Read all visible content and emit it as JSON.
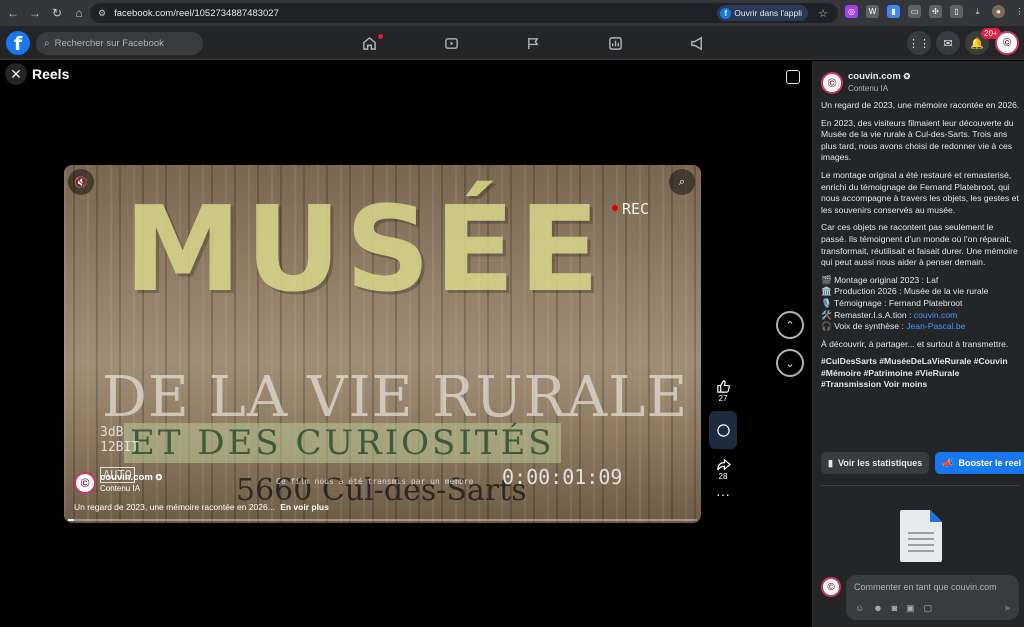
{
  "browser": {
    "url": "facebook.com/reel/1052734887483027",
    "open_app_label": "Ouvrir dans l'appli"
  },
  "header": {
    "search_placeholder": "Rechercher sur Facebook",
    "notifications_badge": "20+"
  },
  "reels": {
    "title": "Reels"
  },
  "video": {
    "overlay_musee": "MUSÉE",
    "overlay_vie": "DE LA VIE RURALE",
    "overlay_curio": "ET DES CURIOSITÉS",
    "overlay_city": "5660 Cul-des-Sarts",
    "overlay_rec": "REC",
    "overlay_db": "3dB\n12BIT",
    "overlay_auto": "AUTO",
    "overlay_time": "0:00:01:09",
    "overlay_transmis": "Ce film nous a été transmis par un membre",
    "author_name": "couvin.com",
    "author_sub": "Contenu IA",
    "caption": "Un regard de 2023, une mémoire racontée en 2026...",
    "see_more": "En voir plus",
    "progress": 0.01
  },
  "actions": {
    "likes": "27",
    "shares": "28"
  },
  "panel": {
    "author_name": "couvin.com",
    "author_sub": "Contenu IA",
    "p1": "Un regard de 2023, une mémoire racontée en 2026.",
    "p2": "En 2023, des visiteurs filmaient leur découverte du Musée de la vie rurale à Cul-des-Sarts. Trois ans plus tard, nous avons choisi de redonner vie à ces images.",
    "p3": "Le montage original a été restauré et remasterisé, enrichi du témoignage de Fernand Platebroot, qui nous accompagne à travers les objets, les gestes et les souvenirs conservés au musée.",
    "p4": "Car ces objets ne racontent pas seulement le passé. Ils témoignent d’un monde où l’on réparait, transformait, réutilisait et faisait durer. Une mémoire qui peut aussi nous aider à penser demain.",
    "credit1": "🎬 Montage original 2023 : Laf",
    "credit2": "🏛️ Production 2026 : Musée de la vie rurale",
    "credit3": "🎙️ Témoignage : Fernand Platebroot",
    "credit4_label": "🛠️ Remaster.I.s.A.tion : ",
    "credit4_link": "couvin.com",
    "credit5_label": "🎧 Voix de synthèse : ",
    "credit5_link": "Jean-Pascal.be",
    "p5": "À découvrir, à partager... et surtout à transmettre.",
    "tags": "#CulDesSarts #MuséeDeLaVieRurale #Couvin #Mémoire #Patrimoine #VieRurale #Transmission Voir moins",
    "stats_button": "Voir les statistiques",
    "boost_button": "Booster le reel",
    "comment_placeholder": "Commenter en tant que couvin.com"
  },
  "colors": {
    "accent": "#1877f2",
    "panel_bg": "#242526",
    "header_bg": "#242526"
  }
}
